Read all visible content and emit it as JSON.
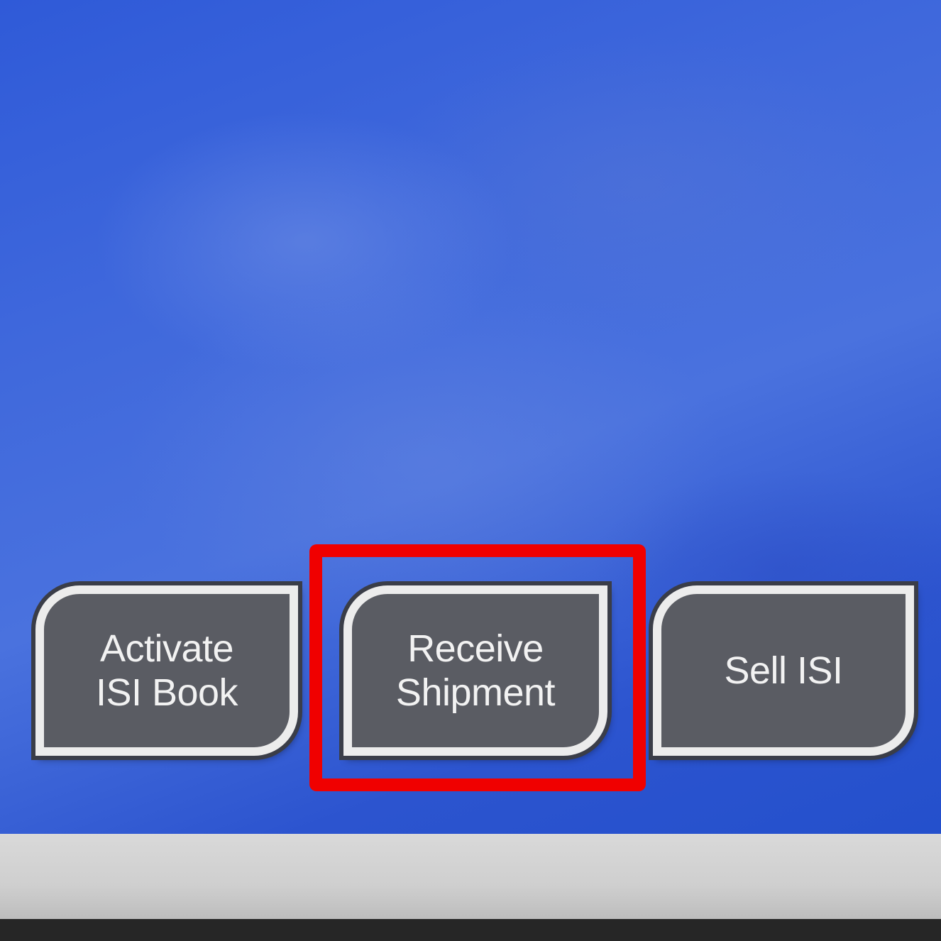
{
  "buttons": [
    {
      "id": "activate",
      "label": "Activate\nISI Book"
    },
    {
      "id": "receive",
      "label": "Receive\nShipment"
    },
    {
      "id": "sell",
      "label": "Sell ISI"
    }
  ],
  "highlight": {
    "target": "receive",
    "color": "#f00000"
  },
  "colors": {
    "screen_blue": "#3f68dc",
    "button_fill": "#5a5c63",
    "button_border": "#ececec",
    "bottom_bar": "#d9d9d9"
  }
}
